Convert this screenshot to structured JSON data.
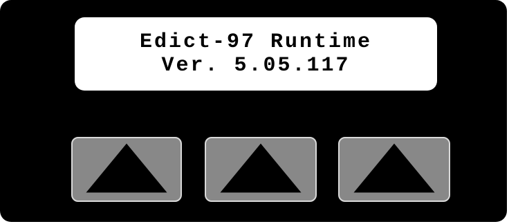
{
  "display": {
    "line1": "Edict-97 Runtime",
    "line2": "Ver. 5.05.117"
  },
  "keys": [
    {
      "icon": "up-triangle-icon"
    },
    {
      "icon": "up-triangle-icon"
    },
    {
      "icon": "up-triangle-icon"
    }
  ],
  "colors": {
    "panel": "#000000",
    "display_background": "#ffffff",
    "display_text": "#000000",
    "key_face": "#888888",
    "key_border": "#d9d9d9",
    "key_arrow": "#000000"
  }
}
